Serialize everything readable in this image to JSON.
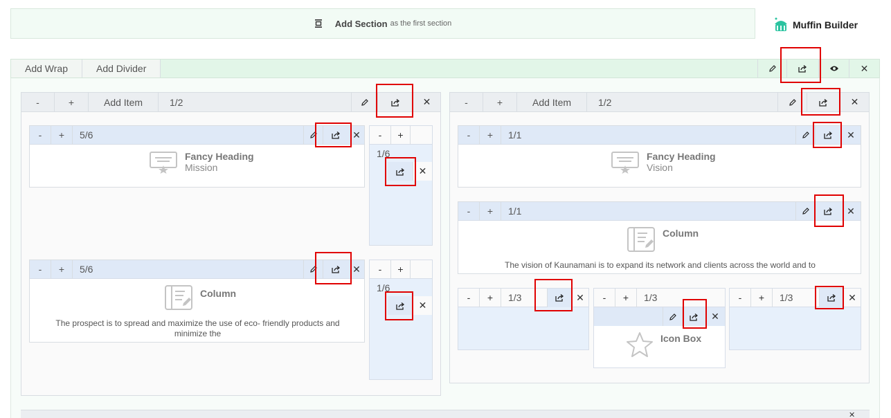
{
  "add_section": {
    "main": "Add Section",
    "suffix": "as the first section"
  },
  "logo": {
    "name": "Muffin Builder"
  },
  "section_bar": {
    "add_wrap": "Add Wrap",
    "add_divider": "Add Divider"
  },
  "left_wrap": {
    "minus": "-",
    "plus": "+",
    "add_item": "Add Item",
    "size": "1/2"
  },
  "right_wrap": {
    "minus": "-",
    "plus": "+",
    "add_item": "Add Item",
    "size": "1/2"
  },
  "items": {
    "lw_heading": {
      "minus": "-",
      "plus": "+",
      "size": "5/6",
      "title": "Fancy Heading",
      "subtitle": "Mission"
    },
    "lw_small1": {
      "minus": "-",
      "plus": "+",
      "size": "1/6"
    },
    "lw_column": {
      "minus": "-",
      "plus": "+",
      "size": "5/6",
      "title": "Column",
      "text": "The prospect is to spread and maximize the use of eco- friendly products and minimize the"
    },
    "lw_small2": {
      "minus": "-",
      "plus": "+",
      "size": "1/6"
    },
    "rw_heading": {
      "minus": "-",
      "plus": "+",
      "size": "1/1",
      "title": "Fancy Heading",
      "subtitle": "Vision"
    },
    "rw_column": {
      "minus": "-",
      "plus": "+",
      "size": "1/1",
      "title": "Column",
      "text": "The vision of Kaunamani is to expand its network and clients across the world and to"
    },
    "rw_third1": {
      "minus": "-",
      "plus": "+",
      "size": "1/3"
    },
    "rw_third2": {
      "minus": "-",
      "plus": "+",
      "size": "1/3",
      "title": "Icon Box"
    },
    "rw_third3": {
      "minus": "-",
      "plus": "+",
      "size": "1/3"
    }
  },
  "icons": {
    "edit": "pencil-icon",
    "export": "export-icon",
    "close": "close-icon",
    "preview": "eye-icon",
    "section": "section-icon"
  },
  "colors": {
    "highlight": "#e00000",
    "section_bg": "#e2f6e8",
    "item_bar": "#dfe9f7"
  }
}
